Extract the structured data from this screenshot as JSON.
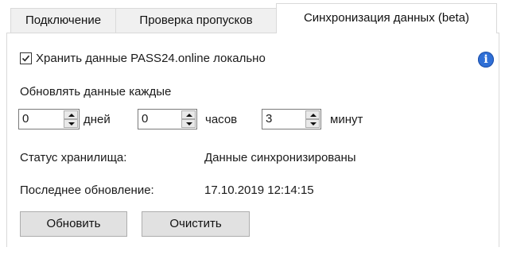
{
  "tabs": [
    {
      "label": "Подключение"
    },
    {
      "label": "Проверка пропусков"
    },
    {
      "label": "Синхронизация данных (beta)"
    }
  ],
  "store_locally": {
    "checked": true,
    "label": "Хранить данные PASS24.online локально"
  },
  "info_icon": {
    "symbol": "i",
    "name": "info-icon"
  },
  "update_interval": {
    "title": "Обновлять данные каждые",
    "days": {
      "value": "0",
      "unit": "дней"
    },
    "hours": {
      "value": "0",
      "unit": "часов"
    },
    "minutes": {
      "value": "3",
      "unit": "минут"
    }
  },
  "status": {
    "label": "Статус хранилища:",
    "value": "Данные синхронизированы"
  },
  "last_update": {
    "label": "Последнее обновление:",
    "value": "17.10.2019 12:14:15"
  },
  "buttons": {
    "refresh": "Обновить",
    "clear": "Очистить"
  },
  "colors": {
    "accent": "#2f6fd6",
    "button_bg": "#e1e1e1",
    "tab_bg": "#f0f0f0"
  }
}
